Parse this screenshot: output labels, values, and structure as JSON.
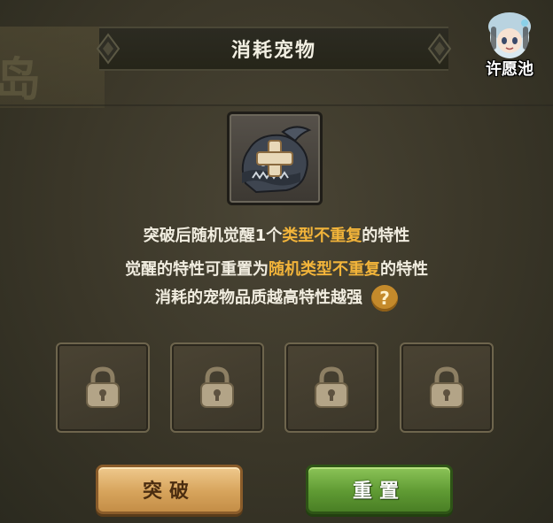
{
  "header": {
    "title": "消耗宠物",
    "wish_pool_label": "许愿池"
  },
  "pet_slot": {
    "icon": "add-pet-plus-icon"
  },
  "description": {
    "line1_a": "突破后随机觉醒1个",
    "line1_hl": "类型不重复",
    "line1_b": "的特性",
    "line2_a": "觉醒的特性可重置为",
    "line2_hl": "随机类型不重复",
    "line2_b": "的特性",
    "line3": "消耗的宠物品质越高特性越强",
    "help_icon": "?"
  },
  "trait_slots": [
    {
      "state": "locked",
      "icon": "lock-icon"
    },
    {
      "state": "locked",
      "icon": "lock-icon"
    },
    {
      "state": "locked",
      "icon": "lock-icon"
    },
    {
      "state": "locked",
      "icon": "lock-icon"
    }
  ],
  "buttons": {
    "breakthrough": "突破",
    "reset": "重置"
  },
  "colors": {
    "highlight": "#f2b43a",
    "text": "#f1ede0",
    "breakthrough_button": "#d7a45c",
    "reset_button": "#5f9a33"
  }
}
